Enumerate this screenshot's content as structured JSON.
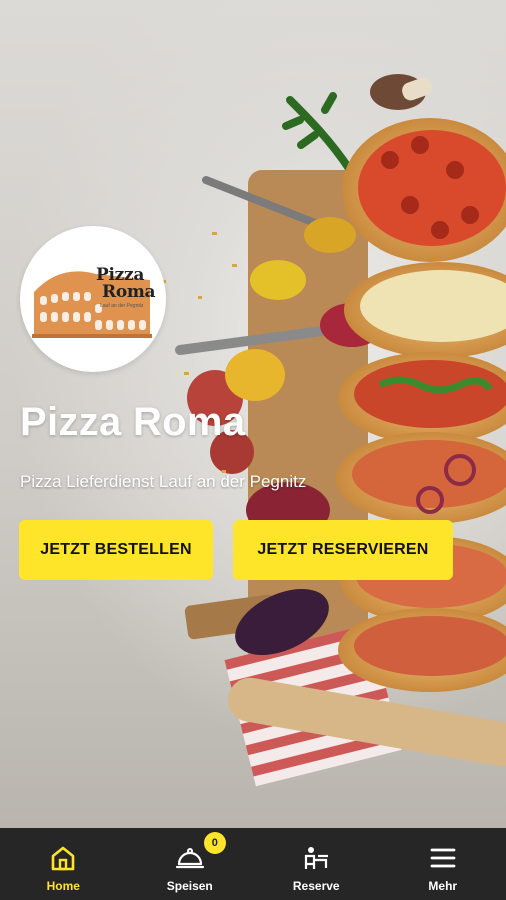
{
  "hero": {
    "logo": {
      "line1": "Pizza",
      "line2": "Roma",
      "tagline": "Lauf an der Pegnitz"
    },
    "title": "Pizza Roma",
    "subtitle": "Pizza Lieferdienst Lauf an der Pegnitz",
    "buttons": {
      "order_label": "JETZT BESTELLEN",
      "reserve_label": "JETZT RESERVIEREN"
    }
  },
  "bottom_nav": {
    "items": [
      {
        "label": "Home",
        "icon": "home-icon",
        "active": true
      },
      {
        "label": "Speisen",
        "icon": "cloche-icon",
        "badge": "0"
      },
      {
        "label": "Reserve",
        "icon": "reserve-icon"
      },
      {
        "label": "Mehr",
        "icon": "menu-icon"
      }
    ]
  },
  "colors": {
    "accent": "#ffe52a",
    "nav_background": "#262626",
    "text_light": "#ffffff"
  }
}
